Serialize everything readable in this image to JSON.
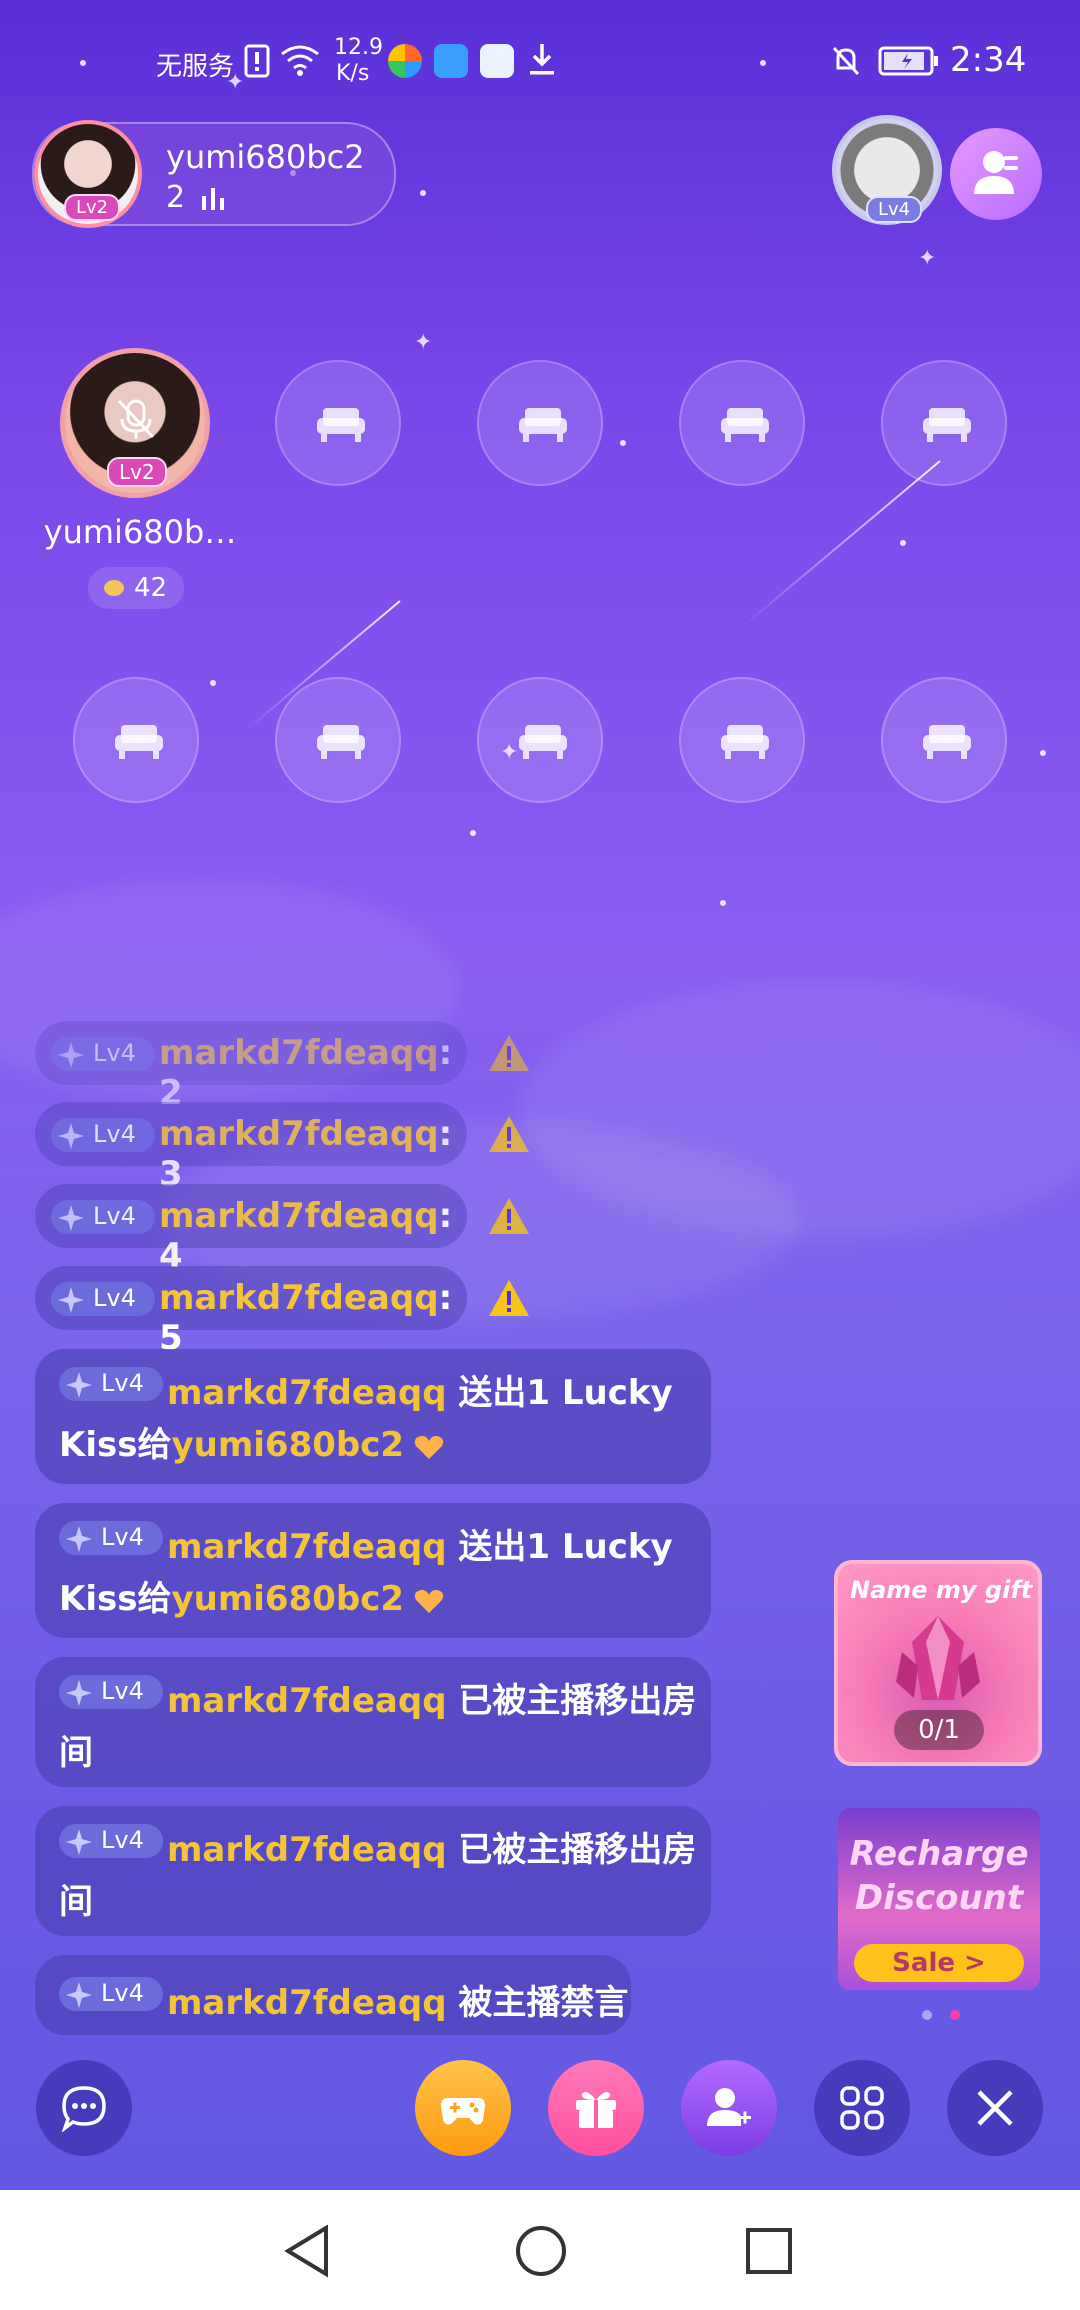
{
  "status_bar": {
    "carrier": "无服务",
    "speed_value": "12.9",
    "speed_unit": "K/s",
    "time": "2:34"
  },
  "header": {
    "host_name": "yumi680bc2",
    "host_level": "Lv2",
    "online_count": "2",
    "viewer_level": "Lv4"
  },
  "seats": {
    "host_name": "yumi680b…",
    "host_level": "Lv2",
    "host_score": "42"
  },
  "chat": {
    "short_lines": [
      {
        "level": "Lv4",
        "user": "markd7fdeaqq",
        "text": ": 2"
      },
      {
        "level": "Lv4",
        "user": "markd7fdeaqq",
        "text": ": 3"
      },
      {
        "level": "Lv4",
        "user": "markd7fdeaqq",
        "text": ": 4"
      },
      {
        "level": "Lv4",
        "user": "markd7fdeaqq",
        "text": ": 5"
      }
    ],
    "cards": [
      {
        "level": "Lv4",
        "user": "markd7fdeaqq",
        "line1": " 送出1 Lucky",
        "line2_prefix": "Kiss给",
        "target": "yumi680bc2"
      },
      {
        "level": "Lv4",
        "user": "markd7fdeaqq",
        "line1": " 送出1 Lucky",
        "line2_prefix": "Kiss给",
        "target": "yumi680bc2"
      },
      {
        "level": "Lv4",
        "user": "markd7fdeaqq",
        "line1": " 已被主播移出房",
        "line2_prefix": "间"
      },
      {
        "level": "Lv4",
        "user": "markd7fdeaqq",
        "line1": " 已被主播移出房",
        "line2_prefix": "间"
      },
      {
        "level": "Lv4",
        "user": "markd7fdeaqq",
        "line1": " 被主播禁言"
      }
    ]
  },
  "promos": {
    "gift_title": "Name my gift",
    "gift_progress": "0/1",
    "recharge_line1": "Recharge",
    "recharge_line2": "Discount",
    "recharge_button": "Sale >"
  },
  "icons": {
    "chat": "chat-bubble-icon",
    "game": "gamepad-icon",
    "gift": "gift-icon",
    "invite": "add-user-icon",
    "menu": "grid-icon",
    "close": "close-icon"
  },
  "colors": {
    "username": "#f3c43a",
    "level_badge": "#6b6bdc",
    "game_btn": "#ffb020",
    "gift_btn": "#ff5fa8"
  }
}
